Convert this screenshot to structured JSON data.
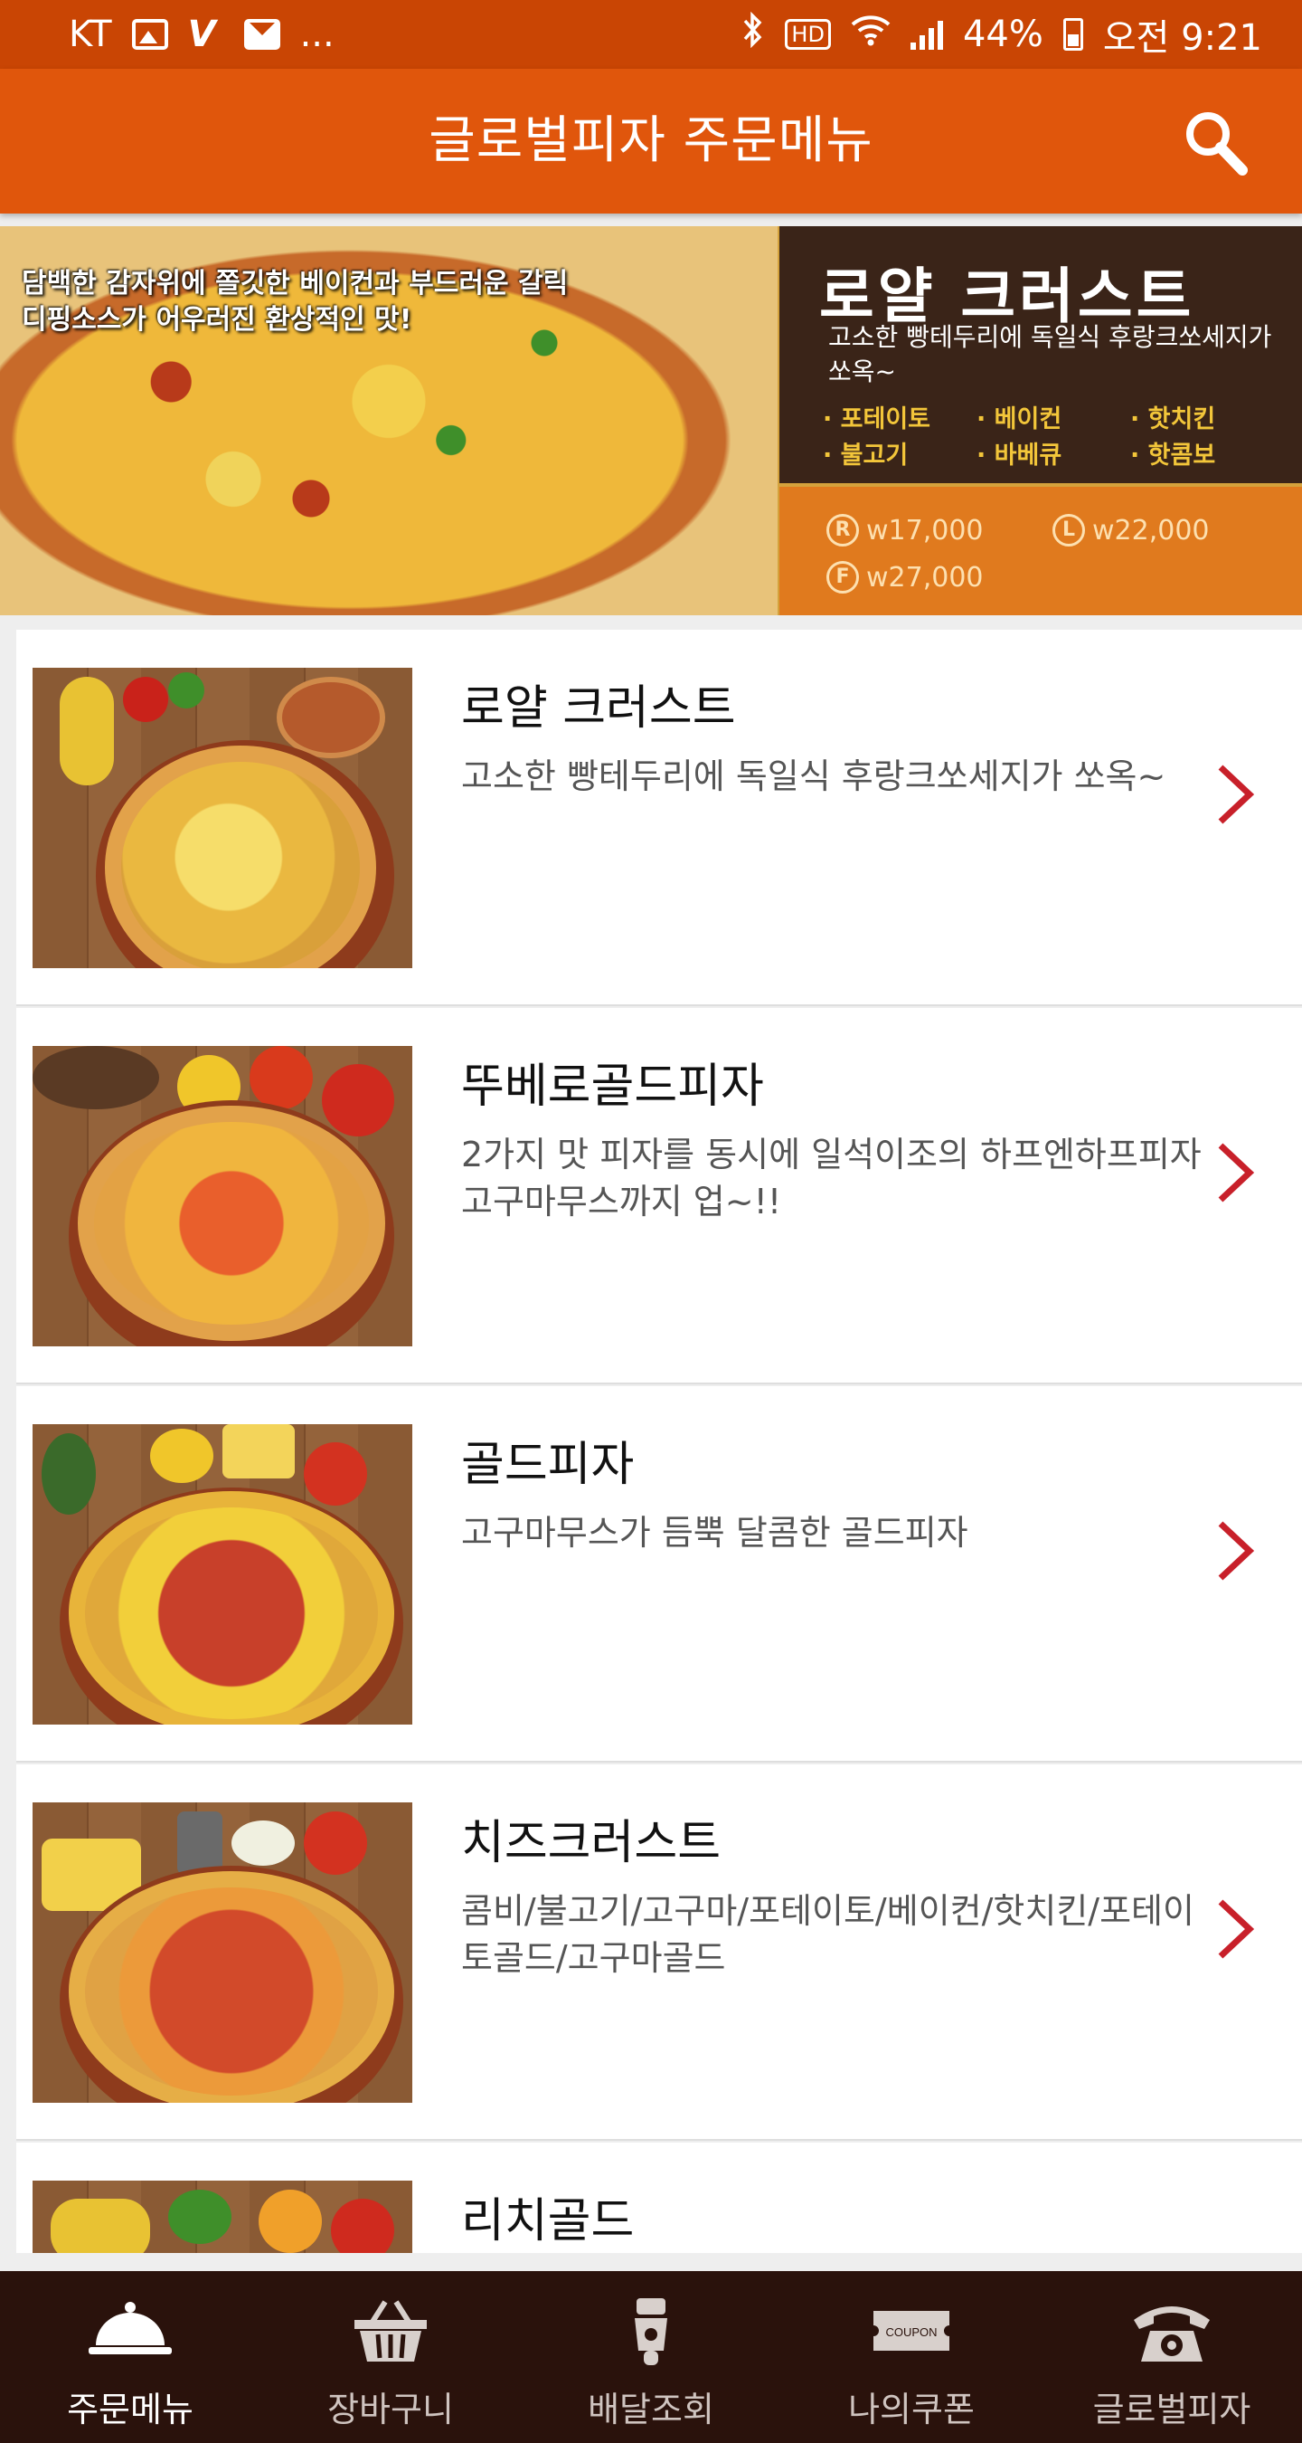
{
  "status_bar": {
    "carrier": "KT",
    "more": "...",
    "hd": "HD",
    "battery": "44%",
    "time": "오전 9:21"
  },
  "app_bar": {
    "title": "글로벌피자 주문메뉴"
  },
  "banner": {
    "tagline": "담백한 감자위에 쫄깃한 베이컨과 부드러운 갈릭디핑소스가 어우러진 환상적인 맛!",
    "name": "로얄 크러스트",
    "desc": "고소한 빵테두리에 독일식 후랑크쏘세지가 쏘옥~",
    "toppings": [
      "· 포테이토",
      "· 베이컨",
      "· 핫치킨",
      "· 불고기",
      "· 바베큐",
      "· 핫콤보"
    ],
    "prices": [
      {
        "size": "R",
        "price": "w17,000"
      },
      {
        "size": "L",
        "price": "w22,000"
      },
      {
        "size": "F",
        "price": "w27,000"
      }
    ]
  },
  "menu_items": [
    {
      "name": "로얄 크러스트",
      "desc": "고소한 빵테두리에 독일식 후랑크쏘세지가 쏘옥~"
    },
    {
      "name": "뚜베로골드피자",
      "desc": "2가지 맛 피자를 동시에 일석이조의 하프엔하프피자 고구마무스까지 업~!!"
    },
    {
      "name": "골드피자",
      "desc": "고구마무스가 듬뿍 달콤한 골드피자"
    },
    {
      "name": "치즈크러스트",
      "desc": "콤비/불고기/고구마/포테이토/베이컨/핫치킨/포테이토골드/고구마골드"
    },
    {
      "name": "리치골드",
      "desc": ""
    }
  ],
  "bottom_nav": [
    {
      "label": "주문메뉴",
      "icon": "cloche-icon",
      "active": true
    },
    {
      "label": "장바구니",
      "icon": "basket-icon",
      "active": false
    },
    {
      "label": "배달조회",
      "icon": "scooter-icon",
      "active": false
    },
    {
      "label": "나의쿠폰",
      "icon": "coupon-icon",
      "active": false
    },
    {
      "label": "글로벌피자",
      "icon": "telephone-icon",
      "active": false
    }
  ],
  "colors": {
    "status_bar": "#c94504",
    "app_bar": "#e0560c",
    "chevron": "#c8202a",
    "bottom_nav": "#2a120c"
  },
  "coupon_icon_text": "COUPON"
}
